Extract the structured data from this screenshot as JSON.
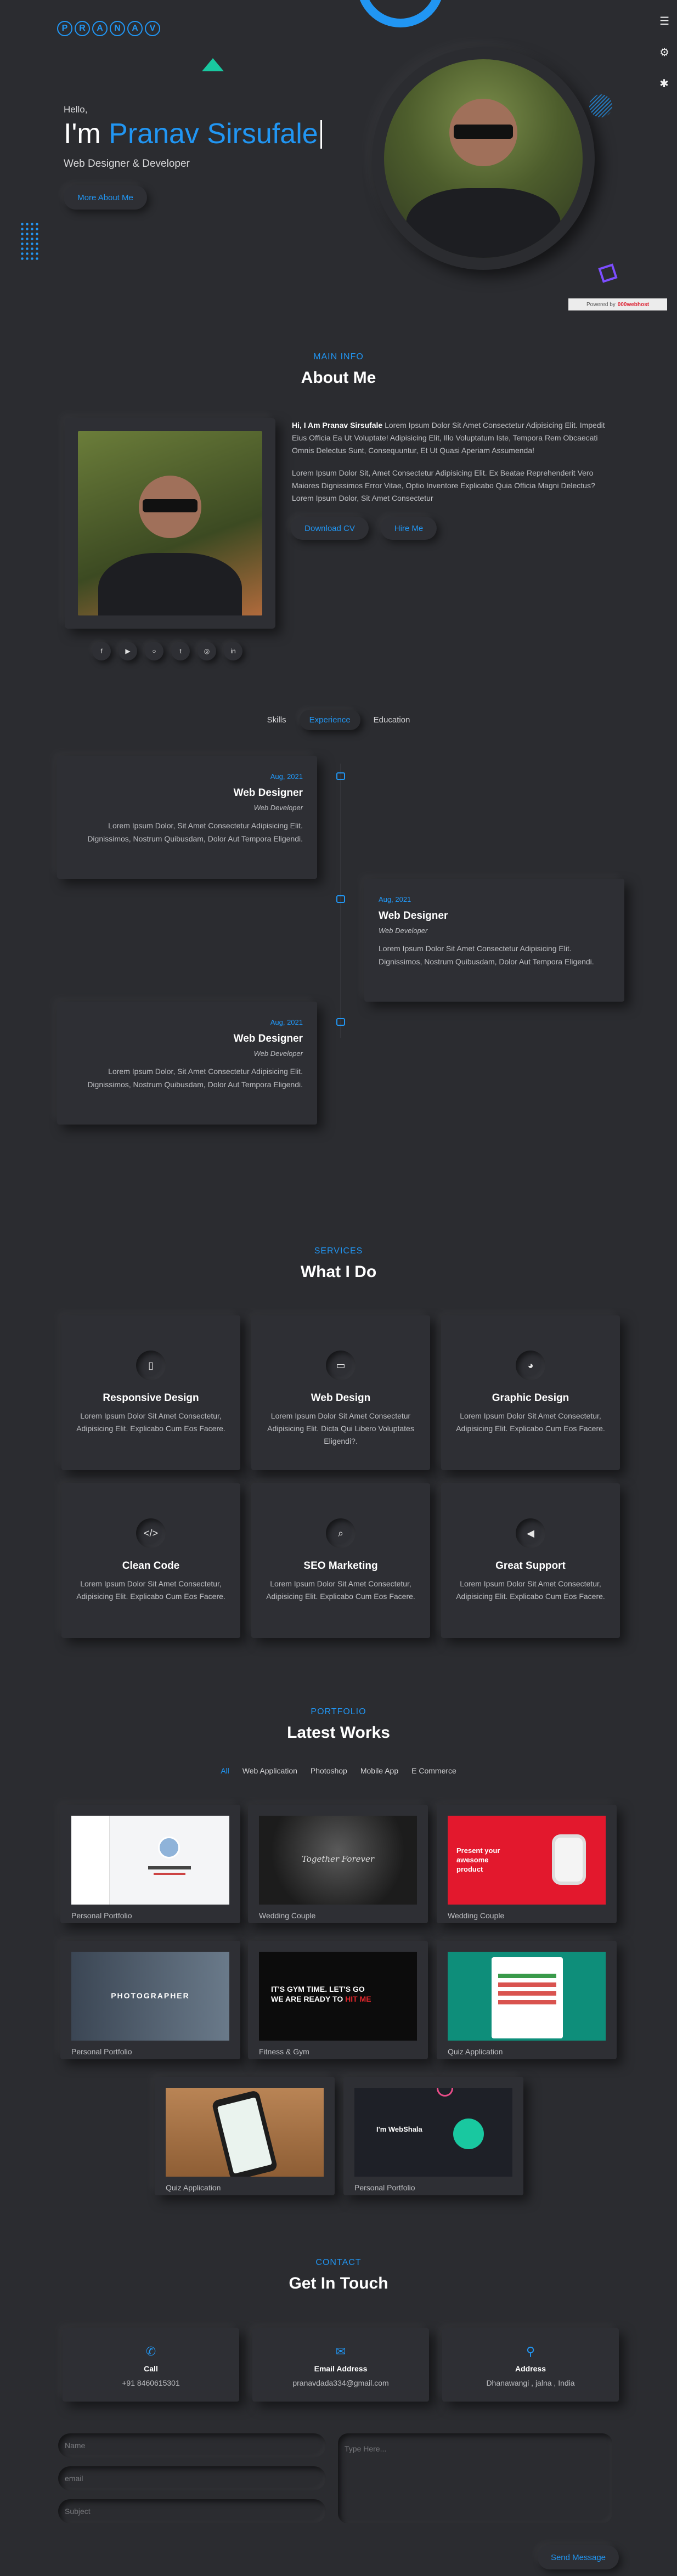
{
  "brand": {
    "letters": [
      "P",
      "R",
      "A",
      "N",
      "A",
      "V"
    ]
  },
  "side_menu": {
    "icons": [
      "menu-icon",
      "gear-icon",
      "gear-alt-icon"
    ]
  },
  "hero": {
    "greeting": "Hello,",
    "prefix": "I'm",
    "name": "Pranav Sirsufale",
    "subtitle": "Web Designer & Developer",
    "button": "More About Me",
    "powered_prefix": "Powered by",
    "powered_brand": "000webhost"
  },
  "about": {
    "kicker": "MAIN INFO",
    "title": "About Me",
    "intro_bold": "Hi, I Am Pranav Sirsufale",
    "intro_rest": " Lorem Ipsum Dolor Sit Amet Consectetur Adipisicing Elit. Impedit Eius Officia Ea Ut Voluptate! Adipisicing Elit, Illo Voluptatum Iste, Tempora Rem Obcaecati Omnis Delectus Sunt, Consequuntur, Et Ut Quasi Aperiam Assumenda!",
    "para2": "Lorem Ipsum Dolor Sit, Amet Consectetur Adipisicing Elit. Ex Beatae Reprehenderit Vero Maiores Dignissimos Error Vitae, Optio Inventore Explicabo Quia Officia Magni Delectus? Lorem Ipsum Dolor, Sit Amet Consectetur",
    "btn_cv": "Download CV",
    "btn_hire": "Hire Me",
    "socials": [
      "f",
      "▶",
      "○",
      "t",
      "◎",
      "in"
    ]
  },
  "resume_tabs": {
    "items": [
      "Skills",
      "Experience",
      "Education"
    ],
    "active": "Experience"
  },
  "timeline": [
    {
      "date": "Aug, 2021",
      "role": "Web Designer",
      "sub": "Web Developer",
      "desc": "Lorem Ipsum Dolor, Sit Amet Consectetur Adipisicing Elit. Dignissimos, Nostrum Quibusdam, Dolor Aut Tempora Eligendi."
    },
    {
      "date": "Aug, 2021",
      "role": "Web Designer",
      "sub": "Web Developer",
      "desc": "Lorem Ipsum Dolor Sit Amet Consectetur Adipisicing Elit. Dignissimos, Nostrum Quibusdam, Dolor Aut Tempora Eligendi."
    },
    {
      "date": "Aug, 2021",
      "role": "Web Designer",
      "sub": "Web Developer",
      "desc": "Lorem Ipsum Dolor, Sit Amet Consectetur Adipisicing Elit. Dignissimos, Nostrum Quibusdam, Dolor Aut Tempora Eligendi."
    }
  ],
  "services": {
    "kicker": "SERVICES",
    "title": "What I Do",
    "items": [
      {
        "icon": "mobile-icon",
        "glyph": "▯",
        "title": "Responsive Design",
        "desc": "Lorem Ipsum Dolor Sit Amet Consectetur, Adipisicing Elit. Explicabo Cum Eos Facere."
      },
      {
        "icon": "laptop-icon",
        "glyph": "▭",
        "title": "Web Design",
        "desc": "Lorem Ipsum Dolor Sit Amet Consectetur Adipisicing Elit. Dicta Qui Libero Voluptates Eligendi?."
      },
      {
        "icon": "palette-icon",
        "glyph": "◕",
        "title": "Graphic Design",
        "desc": "Lorem Ipsum Dolor Sit Amet Consectetur, Adipisicing Elit. Explicabo Cum Eos Facere."
      },
      {
        "icon": "code-icon",
        "glyph": "</>",
        "title": "Clean Code",
        "desc": "Lorem Ipsum Dolor Sit Amet Consectetur, Adipisicing Elit. Explicabo Cum Eos Facere."
      },
      {
        "icon": "search-icon",
        "glyph": "⌕",
        "title": "SEO Marketing",
        "desc": "Lorem Ipsum Dolor Sit Amet Consectetur, Adipisicing Elit. Explicabo Cum Eos Facere."
      },
      {
        "icon": "megaphone-icon",
        "glyph": "◀",
        "title": "Great Support",
        "desc": "Lorem Ipsum Dolor Sit Amet Consectetur, Adipisicing Elit. Explicabo Cum Eos Facere."
      }
    ]
  },
  "portfolio": {
    "kicker": "PORTFOLIO",
    "title": "Latest Works",
    "filters": [
      "All",
      "Web Application",
      "Photoshop",
      "Mobile App",
      "E Commerce"
    ],
    "active_filter": "All",
    "items": [
      {
        "label": "Personal Portfolio"
      },
      {
        "label": "Wedding Couple",
        "thumb_text": "Together Forever"
      },
      {
        "label": "Wedding Couple",
        "thumb_text": "Present your awesome product"
      },
      {
        "label": "Personal Portfolio",
        "thumb_text": "PHOTOGRAPHER"
      },
      {
        "label": "Fitness & Gym",
        "thumb_text_a": "IT'S GYM TIME. LET'S GO",
        "thumb_text_b": "WE ARE READY TO",
        "thumb_text_c": "HIT ME"
      },
      {
        "label": "Quiz Application"
      },
      {
        "label": "Quiz Application"
      },
      {
        "label": "Personal Portfolio",
        "thumb_text": "I'm WebShala"
      }
    ]
  },
  "contact": {
    "kicker": "CONTACT",
    "title": "Get In Touch",
    "cards": [
      {
        "icon": "phone-icon",
        "glyph": "✆",
        "label": "Call",
        "value": "+91 8460615301"
      },
      {
        "icon": "envelope-icon",
        "glyph": "✉",
        "label": "Email Address",
        "value": "pranavdada334@gmail.com"
      },
      {
        "icon": "location-pin-icon",
        "glyph": "⚲",
        "label": "Address",
        "value": "Dhanawangi , jalna , India"
      }
    ],
    "form": {
      "name_placeholder": "Name",
      "email_placeholder": "email",
      "subject_placeholder": "Subject",
      "message_placeholder": "Type Here...",
      "submit": "Send Message"
    }
  },
  "colors": {
    "accent": "#2196f3",
    "background": "#2b2c30",
    "teal": "#19c8a0",
    "purple": "#7c4dff"
  }
}
